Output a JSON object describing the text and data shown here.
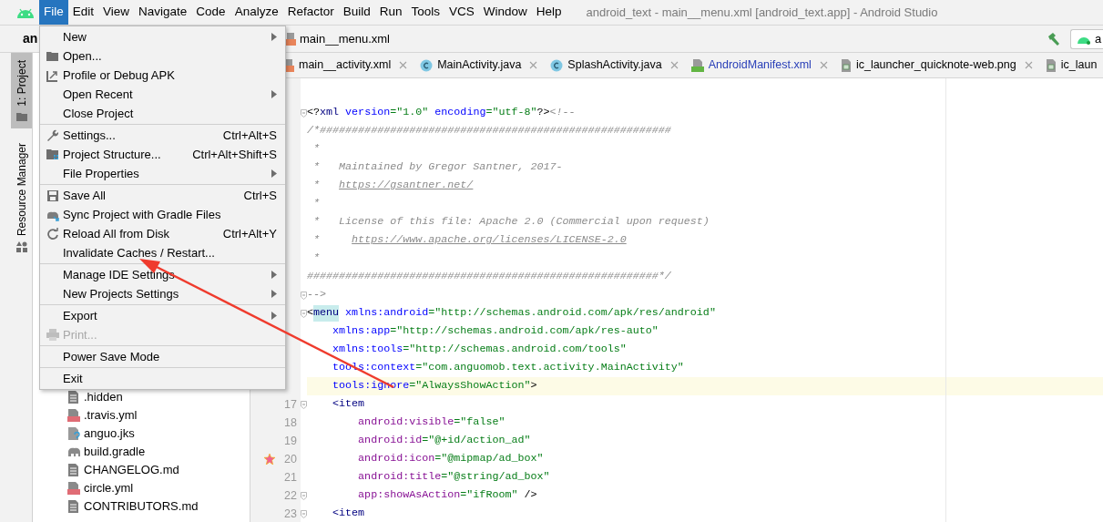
{
  "menubar": [
    {
      "label": "File",
      "selected": true
    },
    {
      "label": "Edit",
      "selected": false
    },
    {
      "label": "View",
      "selected": false
    },
    {
      "label": "Navigate",
      "selected": false
    },
    {
      "label": "Code",
      "selected": false
    },
    {
      "label": "Analyze",
      "selected": false
    },
    {
      "label": "Refactor",
      "selected": false
    },
    {
      "label": "Build",
      "selected": false
    },
    {
      "label": "Run",
      "selected": false
    },
    {
      "label": "Tools",
      "selected": false
    },
    {
      "label": "VCS",
      "selected": false
    },
    {
      "label": "Window",
      "selected": false
    },
    {
      "label": "Help",
      "selected": false
    }
  ],
  "window": {
    "title": "android_text - main__menu.xml [android_text.app] - Android Studio"
  },
  "navbar": {
    "project": "an",
    "breadcrumb": "main__menu.xml",
    "run_config": "a"
  },
  "tool_stripe": [
    {
      "label": "1: Project",
      "selected": true
    },
    {
      "label": "Resource Manager",
      "selected": false
    }
  ],
  "tabs": [
    {
      "label": "main__activity.xml",
      "kind": "xml",
      "modified": false,
      "closable": true
    },
    {
      "label": "MainActivity.java",
      "kind": "class",
      "modified": false,
      "closable": true
    },
    {
      "label": "SplashActivity.java",
      "kind": "class",
      "modified": false,
      "closable": true
    },
    {
      "label": "AndroidManifest.xml",
      "kind": "manifest",
      "modified": true,
      "closable": true
    },
    {
      "label": "ic_launcher_quicknote-web.png",
      "kind": "image",
      "modified": false,
      "closable": true
    },
    {
      "label": "ic_laun",
      "kind": "image",
      "modified": false,
      "closable": false
    }
  ],
  "project_tree": [
    {
      "label": ".hidden",
      "kind": "text"
    },
    {
      "label": ".travis.yml",
      "kind": "yml"
    },
    {
      "label": "anguo.jks",
      "kind": "key"
    },
    {
      "label": "build.gradle",
      "kind": "gradle"
    },
    {
      "label": "CHANGELOG.md",
      "kind": "text"
    },
    {
      "label": "circle.yml",
      "kind": "yml"
    },
    {
      "label": "CONTRIBUTORS.md",
      "kind": "text"
    }
  ],
  "code": [
    {
      "fold": true,
      "text": "<?xml version=\"1.0\" encoding=\"utf-8\"?><!--"
    },
    {
      "text": "/*#######################################################"
    },
    {
      "text": " *"
    },
    {
      "text": " *   Maintained by Gregor Santner, 2017-"
    },
    {
      "text": " *   https://gsantner.net/"
    },
    {
      "text": " *"
    },
    {
      "text": " *   License of this file: Apache 2.0 (Commercial upon request)"
    },
    {
      "text": " *     https://www.apache.org/licenses/LICENSE-2.0"
    },
    {
      "text": " *"
    },
    {
      "text": "#######################################################*/"
    },
    {
      "fold": true,
      "text": "-->"
    },
    {
      "fold": true,
      "tag_highlighted": true,
      "text": "<menu xmlns:android=\"http://schemas.android.com/apk/res/android\""
    },
    {
      "text": "    xmlns:app=\"http://schemas.android.com/apk/res-auto\""
    },
    {
      "text": "    xmlns:tools=\"http://schemas.android.com/tools\""
    },
    {
      "text": "    tools:context=\"com.anguomob.text.activity.MainActivity\""
    },
    {
      "current": true,
      "text": "    tools:ignore=\"AlwaysShowAction\">"
    },
    {
      "number": "17",
      "fold": true,
      "text": "    <item"
    },
    {
      "number": "18",
      "text": "        android:visible=\"false\""
    },
    {
      "number": "19",
      "text": "        android:id=\"@+id/action_ad\""
    },
    {
      "number": "20",
      "gutter_icon": true,
      "text": "        android:icon=\"@mipmap/ad_box\""
    },
    {
      "number": "21",
      "text": "        android:title=\"@string/ad_box\""
    },
    {
      "number": "22",
      "fold": true,
      "text": "        app:showAsAction=\"ifRoom\" />"
    },
    {
      "number": "23",
      "fold": true,
      "text": "    <item"
    }
  ],
  "file_menu": [
    {
      "kind": "item",
      "label": "New",
      "submenu": true
    },
    {
      "kind": "item",
      "label": "Open..."
    },
    {
      "kind": "item",
      "label": "Profile or Debug APK"
    },
    {
      "kind": "item",
      "label": "Open Recent",
      "submenu": true
    },
    {
      "kind": "item",
      "label": "Close Project"
    },
    {
      "kind": "separator"
    },
    {
      "kind": "item",
      "label": "Settings...",
      "shortcut": "Ctrl+Alt+S"
    },
    {
      "kind": "item",
      "label": "Project Structure...",
      "shortcut": "Ctrl+Alt+Shift+S"
    },
    {
      "kind": "item",
      "label": "File Properties",
      "submenu": true
    },
    {
      "kind": "separator"
    },
    {
      "kind": "item",
      "label": "Save All",
      "shortcut": "Ctrl+S"
    },
    {
      "kind": "item",
      "label": "Sync Project with Gradle Files"
    },
    {
      "kind": "item",
      "label": "Reload All from Disk",
      "shortcut": "Ctrl+Alt+Y"
    },
    {
      "kind": "item",
      "label": "Invalidate Caches / Restart..."
    },
    {
      "kind": "separator"
    },
    {
      "kind": "item",
      "label": "Manage IDE Settings",
      "submenu": true
    },
    {
      "kind": "item",
      "label": "New Projects Settings",
      "submenu": true
    },
    {
      "kind": "separator"
    },
    {
      "kind": "item",
      "label": "Export",
      "submenu": true
    },
    {
      "kind": "item",
      "label": "Print...",
      "disabled": true
    },
    {
      "kind": "separator"
    },
    {
      "kind": "item",
      "label": "Power Save Mode"
    },
    {
      "kind": "separator"
    },
    {
      "kind": "item",
      "label": "Exit"
    }
  ]
}
